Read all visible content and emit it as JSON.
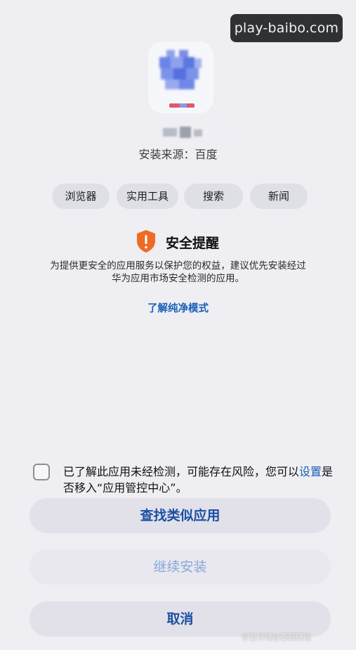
{
  "watermark": "play-baibo.com",
  "app": {
    "icon_name": "app-icon-pixelated",
    "source_label": "安装来源：百度"
  },
  "tags": [
    "浏览器",
    "实用工具",
    "搜索",
    "新闻"
  ],
  "warning": {
    "icon_name": "shield-warning-icon",
    "title": "安全提醒",
    "description_line1": "为提供更安全的应用服务以保护您的权益，建议优先安装经过",
    "description_line2": "华为应用市场安全检测的应用。",
    "link": "了解纯净模式"
  },
  "consent": {
    "checked": false,
    "text_before": "已了解此应用未经检测，可能存在风险，您可以",
    "link": "设置",
    "text_after": "是否移入“应用管控中心”。"
  },
  "buttons": {
    "find_similar": "查找类似应用",
    "continue_install": "继续安装",
    "cancel": "取消"
  },
  "colors": {
    "background": "#eeeef3",
    "accent": "#1c4fa3",
    "warning": "#ef6a24"
  },
  "corner_watermark": "＠爱伴理@要跟随活"
}
